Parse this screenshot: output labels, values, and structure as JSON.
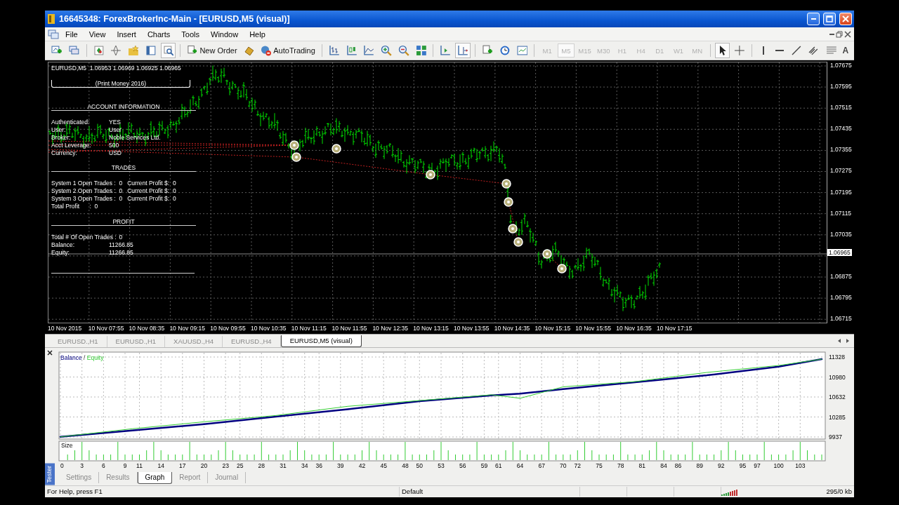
{
  "window": {
    "title": "16645348: ForexBrokerInc-Main - [EURUSD,M5 (visual)]"
  },
  "menu": [
    {
      "label": "File"
    },
    {
      "label": "View"
    },
    {
      "label": "Insert"
    },
    {
      "label": "Charts"
    },
    {
      "label": "Tools"
    },
    {
      "label": "Window"
    },
    {
      "label": "Help"
    }
  ],
  "toolbar": {
    "new_order": "New Order",
    "auto_trading": "AutoTrading",
    "text_tool": "A",
    "timeframes": [
      {
        "label": "M1",
        "selected": false
      },
      {
        "label": "M5",
        "selected": true
      },
      {
        "label": "M15",
        "selected": false
      },
      {
        "label": "M30",
        "selected": false
      },
      {
        "label": "H1",
        "selected": false
      },
      {
        "label": "H4",
        "selected": false
      },
      {
        "label": "D1",
        "selected": false
      },
      {
        "label": "W1",
        "selected": false
      },
      {
        "label": "MN",
        "selected": false
      }
    ]
  },
  "chart": {
    "header": "EURUSD,M5  1.06953 1.06969 1.06925 1.06965",
    "panel": {
      "title": "(Print Money 2016)",
      "sections": [
        {
          "heading": "ACCOUNT INFORMATION",
          "kind": "pairs",
          "rows": [
            {
              "label": "Authenticated:",
              "value": "YES"
            },
            {
              "label": "User:",
              "value": "User"
            },
            {
              "label": "Broker:",
              "value": "Noble Services Ltd."
            },
            {
              "label": "Acct Leverage:",
              "value": "500"
            },
            {
              "label": "Currency:",
              "value": "USD"
            }
          ]
        },
        {
          "heading": "TRADES",
          "kind": "lines",
          "lines": [
            "System 1 Open Trades :  0   Current Profit $:  0",
            "System 2 Open Trades :  0   Current Profit $:  0",
            "System 3 Open Trades :  0   Current Profit $:  0",
            "Total Profit      :  0"
          ]
        },
        {
          "heading": "PROFIT",
          "kind": "pairs",
          "rows": [
            {
              "label": "Total # Of Open Trades :",
              "value": "0"
            },
            {
              "label": "Balance:",
              "value": "11266.85"
            },
            {
              "label": "Equity:",
              "value": "11266.85"
            }
          ]
        }
      ]
    },
    "price_axis": [
      "1.07675",
      "1.07595",
      "1.07515",
      "1.07435",
      "1.07355",
      "1.07275",
      "1.07195",
      "1.07115",
      "1.07035",
      "1.06875",
      "1.06795",
      "1.06715"
    ],
    "current_price": "1.06965",
    "time_axis": [
      "10 Nov 2015",
      "10 Nov 07:55",
      "10 Nov 08:35",
      "10 Nov 09:15",
      "10 Nov 09:55",
      "10 Nov 10:35",
      "10 Nov 11:15",
      "10 Nov 11:55",
      "10 Nov 12:35",
      "10 Nov 13:15",
      "10 Nov 13:55",
      "10 Nov 14:35",
      "10 Nov 15:15",
      "10 Nov 15:55",
      "10 Nov 16:35",
      "10 Nov 17:15"
    ]
  },
  "chart_tabs": [
    {
      "label": "EURUSD.,H1",
      "selected": false
    },
    {
      "label": "EURUSD.,H1",
      "selected": false
    },
    {
      "label": "XAUUSD.,H4",
      "selected": false
    },
    {
      "label": "EURUSD.,H4",
      "selected": false
    },
    {
      "label": "EURUSD,M5 (visual)",
      "selected": true
    }
  ],
  "tester": {
    "label": "Tester",
    "size_label": "Size",
    "legend_separator": "/",
    "chart_data": {
      "type": "line",
      "x": [
        0,
        10,
        20,
        30,
        40,
        50,
        60,
        64,
        70,
        80,
        90,
        100,
        106
      ],
      "series": [
        {
          "name": "Balance",
          "color": "#000080",
          "values": [
            9940,
            10050,
            10160,
            10290,
            10420,
            10560,
            10660,
            10690,
            10770,
            10890,
            11010,
            11160,
            11290
          ]
        },
        {
          "name": "Equity",
          "color": "#33cc33",
          "values": [
            9940,
            10080,
            10200,
            10310,
            10470,
            10570,
            10670,
            10610,
            10810,
            10900,
            11060,
            11180,
            11290
          ]
        }
      ],
      "grid": true,
      "xlim": [
        0,
        106
      ],
      "ylim": [
        9937,
        11328
      ],
      "yticks": [
        9937,
        10285,
        10632,
        10980,
        11328
      ],
      "xticks": [
        0,
        3,
        6,
        9,
        11,
        14,
        17,
        20,
        23,
        25,
        28,
        31,
        34,
        36,
        39,
        42,
        45,
        48,
        50,
        53,
        56,
        59,
        61,
        64,
        67,
        70,
        72,
        75,
        78,
        81,
        84,
        86,
        89,
        92,
        95,
        97,
        100,
        103
      ]
    },
    "tabs": [
      {
        "label": "Settings",
        "selected": false
      },
      {
        "label": "Results",
        "selected": false
      },
      {
        "label": "Graph",
        "selected": true
      },
      {
        "label": "Report",
        "selected": false
      },
      {
        "label": "Journal",
        "selected": false
      }
    ]
  },
  "status_bar": {
    "help": "For Help, press F1",
    "profile": "Default",
    "traffic": "295/0 kb"
  }
}
